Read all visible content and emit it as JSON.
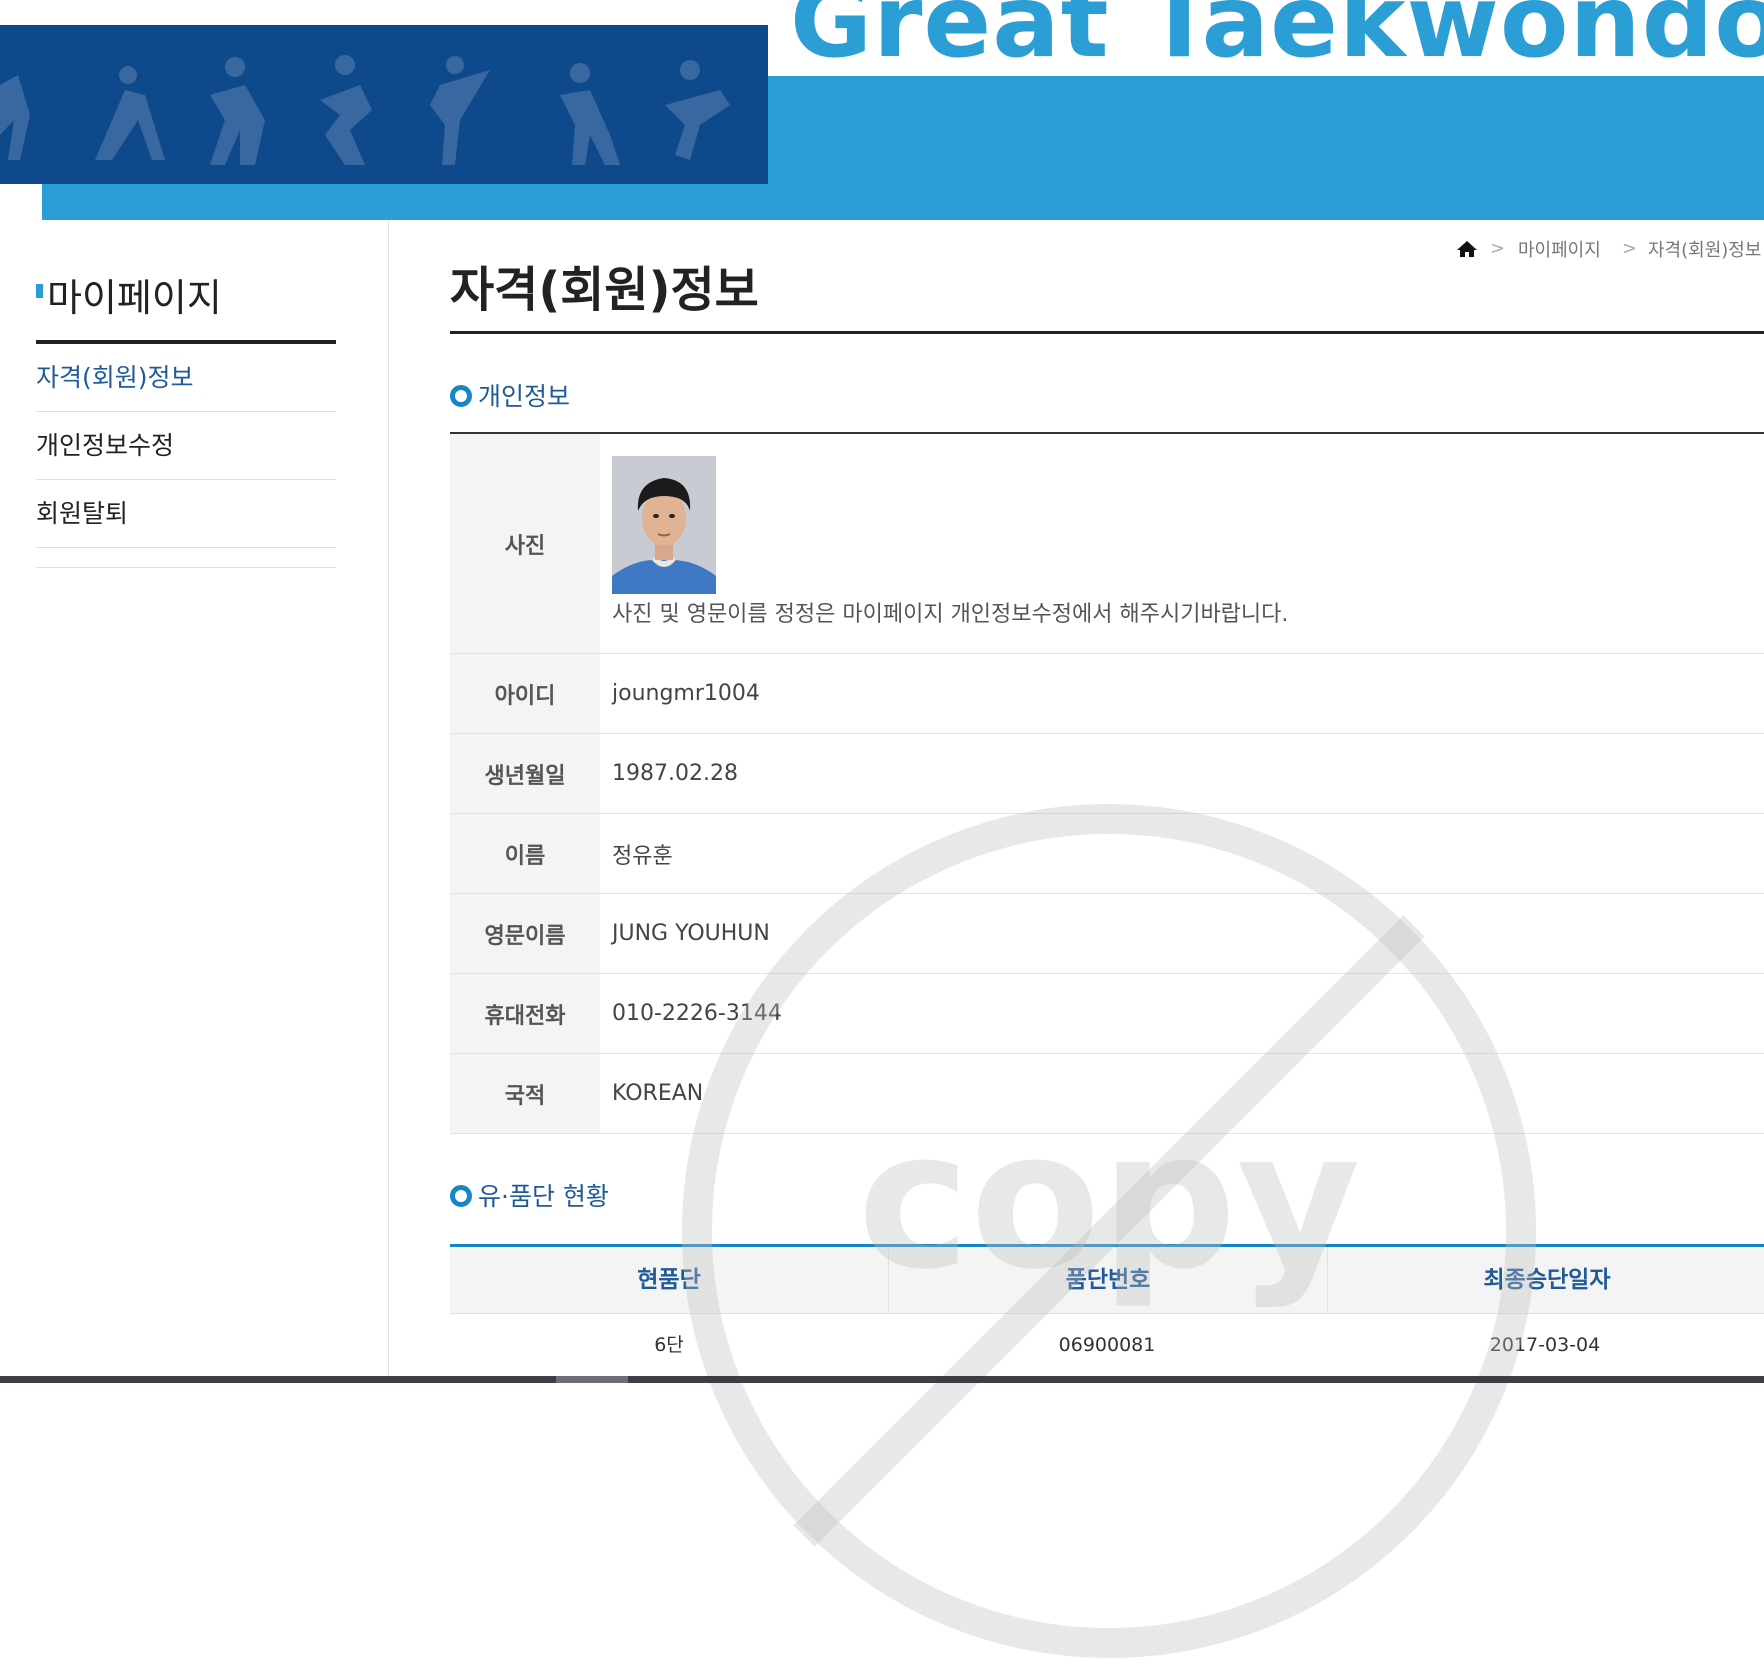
{
  "banner": {
    "title": "Great Taekwondo!",
    "colors": {
      "dark": "#0e4a8b",
      "light": "#2b9ed6"
    }
  },
  "sidebar": {
    "title": "마이페이지",
    "items": [
      {
        "label": "자격(회원)정보",
        "active": true
      },
      {
        "label": "개인정보수정",
        "active": false
      },
      {
        "label": "회원탈퇴",
        "active": false
      }
    ]
  },
  "breadcrumb": {
    "home_icon": "home-icon",
    "items": [
      "마이페이지",
      "자격(회원)정보"
    ]
  },
  "page": {
    "title": "자격(회원)정보"
  },
  "personal": {
    "section_title": "개인정보",
    "photo_label": "사진",
    "photo_note": "사진 및 영문이름 정정은 마이페이지 개인정보수정에서 해주시기바랍니다.",
    "rows": [
      {
        "label": "아이디",
        "value": "joungmr1004"
      },
      {
        "label": "생년월일",
        "value": "1987.02.28"
      },
      {
        "label": "이름",
        "value": "정유훈"
      },
      {
        "label": "영문이름",
        "value": "JUNG YOUHUN"
      },
      {
        "label": "휴대전화",
        "value": "010-2226-3144"
      },
      {
        "label": "국적",
        "value": "KOREAN"
      }
    ]
  },
  "rank": {
    "section_title": "유·품단 현황",
    "headers": [
      "현품단",
      "품단번호",
      "최종승단일자"
    ],
    "rows": [
      [
        "6단",
        "06900081",
        "2017-03-04"
      ]
    ]
  },
  "watermark": {
    "text": "copy"
  }
}
